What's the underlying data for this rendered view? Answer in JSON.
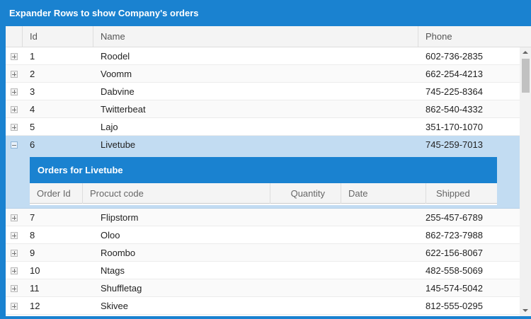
{
  "grid": {
    "caption": "Expander Rows to show Company's orders",
    "columns": {
      "id": "Id",
      "name": "Name",
      "phone": "Phone"
    },
    "rows": [
      {
        "id": "1",
        "name": "Roodel",
        "phone": "602-736-2835"
      },
      {
        "id": "2",
        "name": "Voomm",
        "phone": "662-254-4213"
      },
      {
        "id": "3",
        "name": "Dabvine",
        "phone": "745-225-8364"
      },
      {
        "id": "4",
        "name": "Twitterbeat",
        "phone": "862-540-4332"
      },
      {
        "id": "5",
        "name": "Lajo",
        "phone": "351-170-1070"
      },
      {
        "id": "6",
        "name": "Livetube",
        "phone": "745-259-7013"
      },
      {
        "id": "7",
        "name": "Flipstorm",
        "phone": "255-457-6789"
      },
      {
        "id": "8",
        "name": "Oloo",
        "phone": "862-723-7988"
      },
      {
        "id": "9",
        "name": "Roombo",
        "phone": "622-156-8067"
      },
      {
        "id": "10",
        "name": "Ntags",
        "phone": "482-558-5069"
      },
      {
        "id": "11",
        "name": "Shuffletag",
        "phone": "145-574-5042"
      },
      {
        "id": "12",
        "name": "Skivee",
        "phone": "812-555-0295"
      }
    ]
  },
  "detail": {
    "caption": "Orders for Livetube",
    "columns": {
      "order_id": "Order Id",
      "product_code": "Procuct code",
      "quantity": "Quantity",
      "date": "Date",
      "shipped": "Shipped"
    }
  },
  "colors": {
    "accent": "#1a82d0",
    "expanded_row": "#c2dcf2"
  },
  "icons": {
    "collapsed": "plus-icon",
    "expanded": "minus-icon"
  }
}
